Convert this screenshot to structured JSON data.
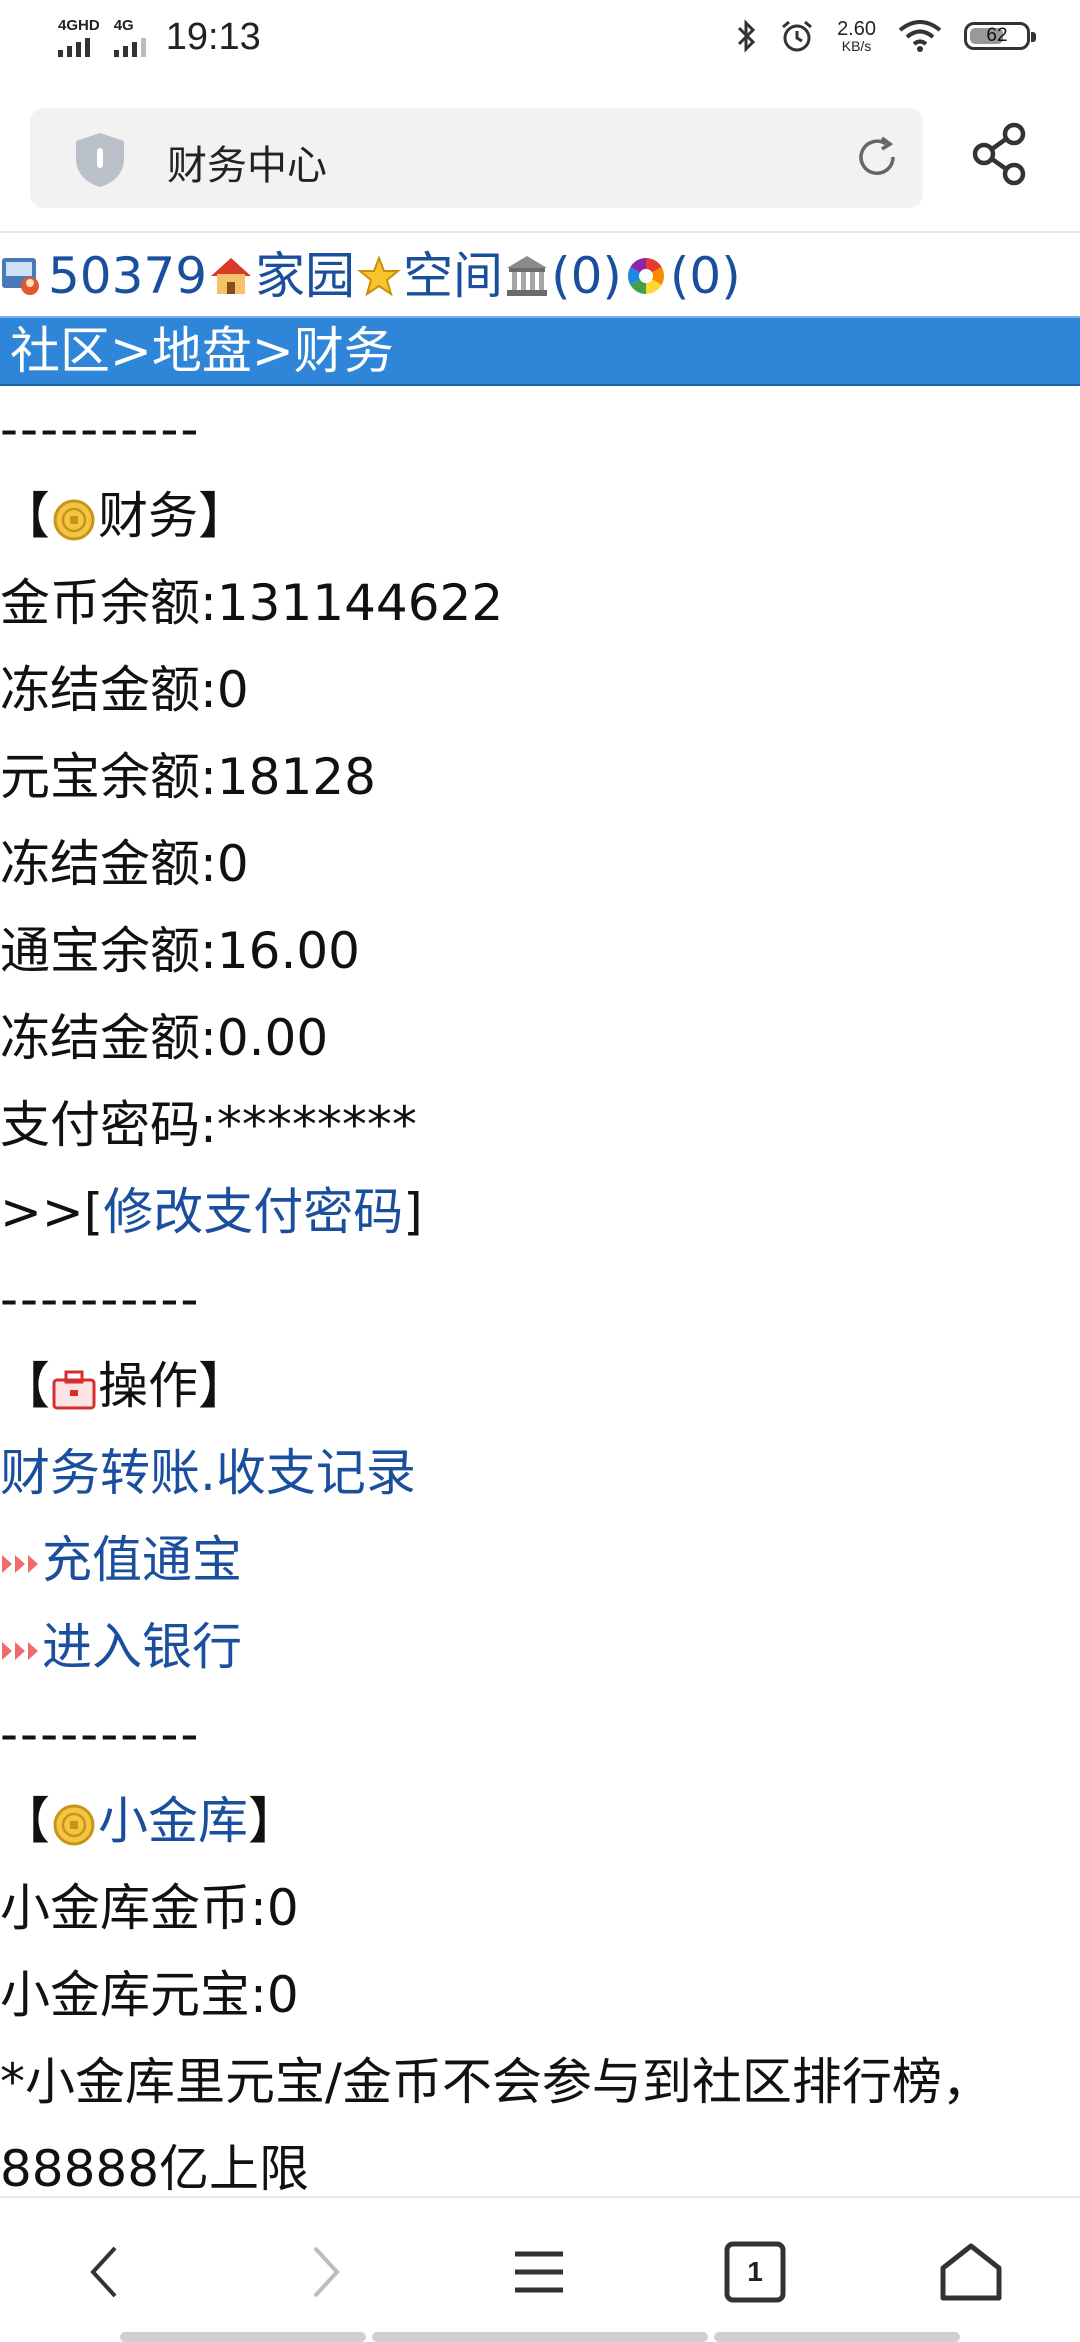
{
  "status": {
    "sim1": "4GHD",
    "sim2": "4G",
    "time": "19:13",
    "speed_value": "2.60",
    "speed_unit": "KB/s",
    "battery": "62",
    "battery_level": 0.62
  },
  "browser": {
    "title": "财务中心"
  },
  "toplinks": {
    "user_id": "50379",
    "home": "家园",
    "space": "空间",
    "bank_count": "(0)",
    "msg_count": "(0)"
  },
  "breadcrumb": "社区>地盘>财务",
  "divider": "----------",
  "finance": {
    "open": "【",
    "title": "财务",
    "close": "】",
    "gold_balance": "金币余额:131144622",
    "gold_frozen": "冻结金额:0",
    "yuanbao_balance": "元宝余额:18128",
    "yuanbao_frozen": "冻结金额:0",
    "tongbao_balance": "通宝余额:16.00",
    "tongbao_frozen": "冻结金额:0.00",
    "pay_password": "支付密码:********",
    "change_prefix": ">>[",
    "change_link": "修改支付密码",
    "change_suffix": "]"
  },
  "operations": {
    "title": "操作",
    "transfer": "财务转账",
    "dot": ".",
    "records": "收支记录",
    "recharge": "充值通宝",
    "bank": "进入银行"
  },
  "vault": {
    "title": "小金库",
    "gold": "小金库金币:0",
    "yuanbao": "小金库元宝:0",
    "note": "*小金库里元宝/金币不会参与到社区排行榜，88888亿上限"
  },
  "nav": {
    "tab_count": "1"
  },
  "colors": {
    "link": "#1a4f9e",
    "breadcrumb_bg": "#2f86d9"
  }
}
